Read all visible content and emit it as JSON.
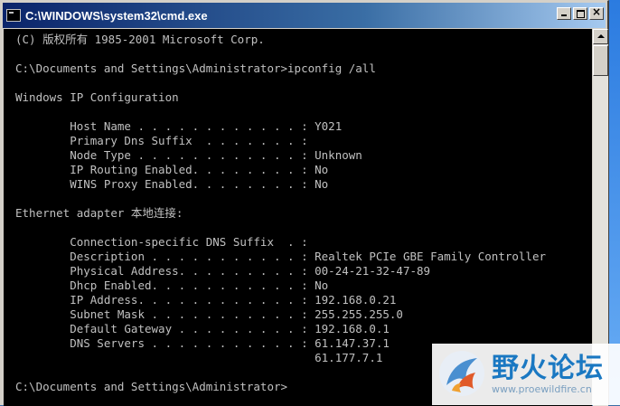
{
  "window": {
    "title": "C:\\WINDOWS\\system32\\cmd.exe",
    "close_glyph": "×"
  },
  "console": {
    "lines": [
      "(C) 版权所有 1985-2001 Microsoft Corp.",
      "",
      "C:\\Documents and Settings\\Administrator>ipconfig /all",
      "",
      "Windows IP Configuration",
      "",
      "        Host Name . . . . . . . . . . . . : Y021",
      "        Primary Dns Suffix  . . . . . . . :",
      "        Node Type . . . . . . . . . . . . : Unknown",
      "        IP Routing Enabled. . . . . . . . : No",
      "        WINS Proxy Enabled. . . . . . . . : No",
      "",
      "Ethernet adapter 本地连接:",
      "",
      "        Connection-specific DNS Suffix  . :",
      "        Description . . . . . . . . . . . : Realtek PCIe GBE Family Controller",
      "        Physical Address. . . . . . . . . : 00-24-21-32-47-89",
      "        Dhcp Enabled. . . . . . . . . . . : No",
      "        IP Address. . . . . . . . . . . . : 192.168.0.21",
      "        Subnet Mask . . . . . . . . . . . : 255.255.255.0",
      "        Default Gateway . . . . . . . . . : 192.168.0.1",
      "        DNS Servers . . . . . . . . . . . : 61.147.37.1",
      "                                            61.177.7.1",
      "",
      "C:\\Documents and Settings\\Administrator>"
    ]
  },
  "watermark": {
    "title": "野火论坛",
    "url": "www.proewildfire.cn"
  },
  "colors": {
    "titlebar_start": "#0a246a",
    "titlebar_end": "#a6caf0",
    "console_bg": "#000000",
    "console_text": "#c0c0c0"
  }
}
